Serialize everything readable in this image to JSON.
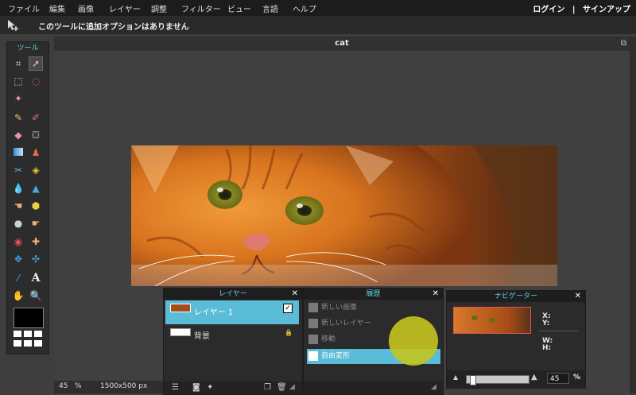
{
  "menu": [
    "ファイル",
    "編集",
    "画像",
    "レイヤー",
    "調整",
    "フィルター",
    "ビュー",
    "言語",
    "ヘルプ"
  ],
  "auth": {
    "login": "ログイン",
    "separator": "|",
    "signup": "サインアップ"
  },
  "options": {
    "tool_icon": "move-tool-icon",
    "message": "このツールに追加オプションはありません"
  },
  "tools": {
    "title": "ツール"
  },
  "document": {
    "title": "cat",
    "zoom": "45",
    "zoom_unit": "%",
    "dimensions": "1500x500 px"
  },
  "layers": {
    "title": "レイヤー",
    "items": [
      {
        "name": "レイヤー 1",
        "selected": true,
        "visible": true
      },
      {
        "name": "背景",
        "selected": false,
        "locked": true
      }
    ]
  },
  "history": {
    "title": "履歴",
    "items": [
      {
        "label": "新しい画像"
      },
      {
        "label": "新しいレイヤー"
      },
      {
        "label": "移動"
      },
      {
        "label": "自由変形",
        "selected": true
      }
    ]
  },
  "navigator": {
    "title": "ナビゲーター",
    "x_label": "X:",
    "y_label": "Y:",
    "w_label": "W:",
    "h_label": "H:",
    "zoom": "45",
    "zoom_unit": "%"
  },
  "colors": {
    "accent": "#5bbcd8",
    "primary_color": "#000000",
    "highlight_blob": "#c4c41f"
  }
}
